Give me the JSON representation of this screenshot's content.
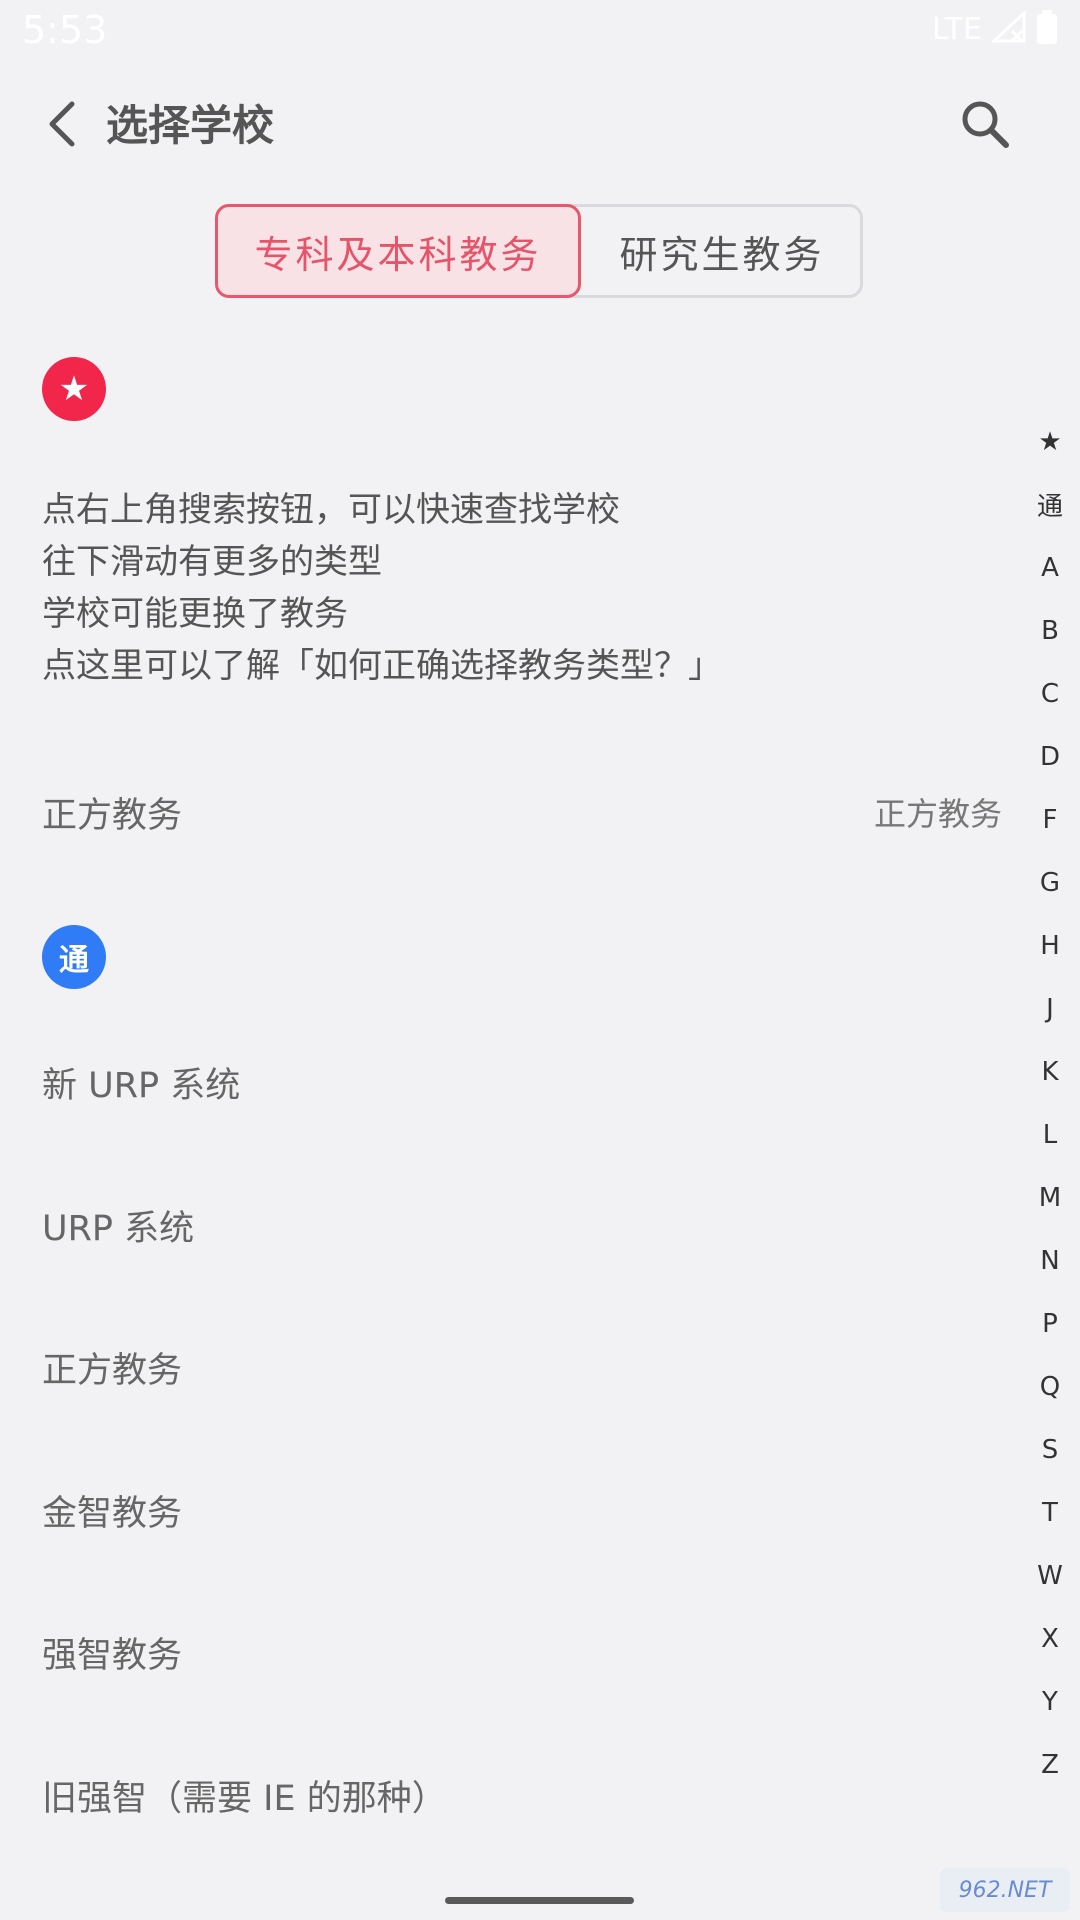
{
  "status_bar": {
    "time": "5:53",
    "network": "LTE"
  },
  "app_bar": {
    "title": "选择学校"
  },
  "tabs": [
    {
      "label": "专科及本科教务",
      "selected": true
    },
    {
      "label": "研究生教务",
      "selected": false
    }
  ],
  "favorites": {
    "badge": "★",
    "hints": [
      "点右上角搜索按钮，可以快速查找学校",
      "往下滑动有更多的类型",
      "学校可能更换了教务",
      "点这里可以了解「如何正确选择教务类型？」"
    ],
    "item": {
      "name": "正方教务",
      "type": "正方教务"
    }
  },
  "general": {
    "badge": "通",
    "items": [
      "新 URP 系统",
      "URP 系统",
      "正方教务",
      "金智教务",
      "强智教务",
      "旧强智（需要 IE 的那种）"
    ]
  },
  "index_letters": [
    "★",
    "通",
    "A",
    "B",
    "C",
    "D",
    "F",
    "G",
    "H",
    "J",
    "K",
    "L",
    "M",
    "N",
    "P",
    "Q",
    "S",
    "T",
    "W",
    "X",
    "Y",
    "Z"
  ],
  "watermark": "962.NET",
  "colors": {
    "accent": "#e8576c",
    "star_badge": "#f2264a",
    "tong_badge": "#2f7cf6",
    "background": "#f2f2f4"
  }
}
